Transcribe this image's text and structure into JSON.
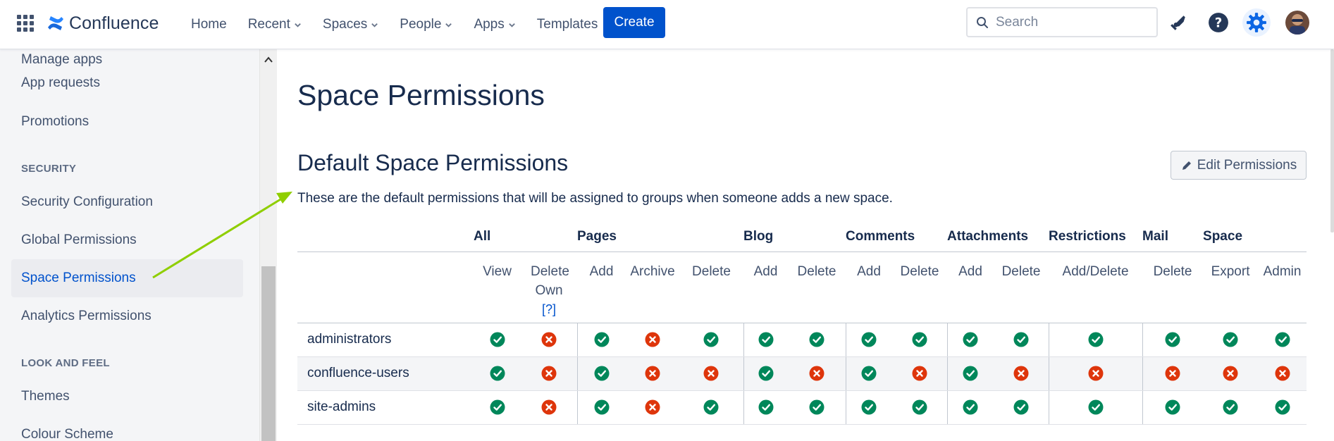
{
  "topbar": {
    "logo_text": "Confluence",
    "nav": [
      {
        "label": "Home",
        "dropdown": false
      },
      {
        "label": "Recent",
        "dropdown": true
      },
      {
        "label": "Spaces",
        "dropdown": true
      },
      {
        "label": "People",
        "dropdown": true
      },
      {
        "label": "Apps",
        "dropdown": true
      },
      {
        "label": "Templates",
        "dropdown": false
      }
    ],
    "create_label": "Create",
    "search_placeholder": "Search",
    "icons": [
      "app-switcher-icon",
      "confluence-logo-icon",
      "notifications-icon",
      "help-icon",
      "settings-icon",
      "user-avatar"
    ]
  },
  "sidebar": {
    "items_top": [
      {
        "label": "Manage apps"
      },
      {
        "label": "App requests"
      },
      {
        "label": "Promotions"
      }
    ],
    "security_heading": "SECURITY",
    "security_items": [
      {
        "label": "Security Configuration"
      },
      {
        "label": "Global Permissions"
      },
      {
        "label": "Space Permissions",
        "active": true
      },
      {
        "label": "Analytics Permissions"
      }
    ],
    "look_heading": "LOOK AND FEEL",
    "look_items": [
      {
        "label": "Themes"
      },
      {
        "label": "Colour Scheme"
      }
    ]
  },
  "main": {
    "page_title": "Space Permissions",
    "section_title": "Default Space Permissions",
    "edit_button": "Edit Permissions",
    "description": "These are the default permissions that will be assigned to groups when someone adds a new space.",
    "table": {
      "groups": [
        {
          "label": "All",
          "span": 2
        },
        {
          "label": "Pages",
          "span": 3
        },
        {
          "label": "Blog",
          "span": 2
        },
        {
          "label": "Comments",
          "span": 2
        },
        {
          "label": "Attachments",
          "span": 2
        },
        {
          "label": "Restrictions",
          "span": 1
        },
        {
          "label": "Mail",
          "span": 1
        },
        {
          "label": "Space",
          "span": 2
        }
      ],
      "columns": [
        "View",
        "Delete Own",
        "Add",
        "Archive",
        "Delete",
        "Add",
        "Delete",
        "Add",
        "Delete",
        "Add",
        "Delete",
        "Add/Delete",
        "Delete",
        "Export",
        "Admin"
      ],
      "help_link": "[?]",
      "rows": [
        {
          "name": "administrators",
          "perms": [
            true,
            false,
            true,
            false,
            true,
            true,
            true,
            true,
            true,
            true,
            true,
            true,
            true,
            true,
            true
          ]
        },
        {
          "name": "confluence-users",
          "perms": [
            true,
            false,
            true,
            false,
            false,
            true,
            false,
            true,
            false,
            true,
            false,
            false,
            false,
            false,
            false
          ]
        },
        {
          "name": "site-admins",
          "perms": [
            true,
            false,
            true,
            false,
            true,
            true,
            true,
            true,
            true,
            true,
            true,
            true,
            true,
            true,
            true
          ]
        }
      ]
    }
  },
  "colors": {
    "brand": "#0052cc",
    "granted": "#00875a",
    "denied": "#de350b",
    "annotation_arrow": "#8fce00"
  }
}
